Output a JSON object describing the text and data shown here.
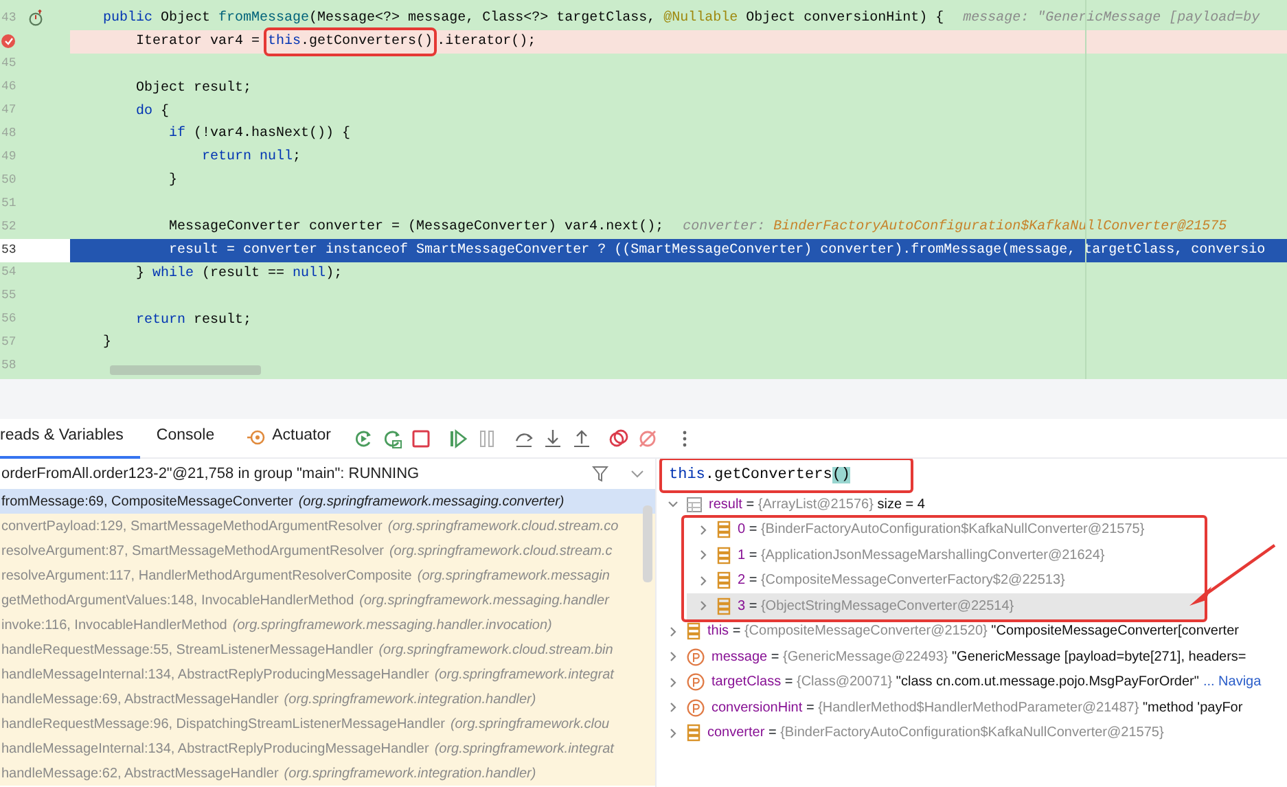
{
  "editor": {
    "lines": [
      {
        "number": "43",
        "override_marker": true,
        "segments": [
          {
            "text": "    public",
            "kind": "kw"
          },
          {
            "text": " Object ",
            "kind": "plain"
          },
          {
            "text": "fromMessage",
            "kind": "method"
          },
          {
            "text": "(Message<?> message, Class<?> targetClass, ",
            "kind": "plain"
          },
          {
            "text": "@Nullable",
            "kind": "annotation"
          },
          {
            "text": " Object conversionHint) {",
            "kind": "plain"
          }
        ],
        "hint": [
          {
            "text": "message: \"GenericMessage [payload=by",
            "kind": "hint"
          }
        ]
      },
      {
        "breakpoint": true,
        "segments": [
          {
            "text": "        Iterator var4 = ",
            "kind": "plain"
          },
          {
            "kind": "callout",
            "parts": [
              {
                "text": "this",
                "kind": "kw"
              },
              {
                "text": ".getConverters()",
                "kind": "plain"
              }
            ]
          },
          {
            "text": ".iterator();",
            "kind": "plain"
          }
        ]
      },
      {
        "number": "45"
      },
      {
        "number": "46",
        "segments": [
          {
            "text": "        Object result;",
            "kind": "plain"
          }
        ]
      },
      {
        "number": "47",
        "segments": [
          {
            "text": "        do",
            "kind": "kw"
          },
          {
            "text": " {",
            "kind": "plain"
          }
        ]
      },
      {
        "number": "48",
        "segments": [
          {
            "text": "            if",
            "kind": "kw"
          },
          {
            "text": " (!var4.hasNext()) {",
            "kind": "plain"
          }
        ]
      },
      {
        "number": "49",
        "segments": [
          {
            "text": "                return null",
            "kind": "kw"
          },
          {
            "text": ";",
            "kind": "plain"
          }
        ]
      },
      {
        "number": "50",
        "segments": [
          {
            "text": "            }",
            "kind": "plain"
          }
        ]
      },
      {
        "number": "51"
      },
      {
        "number": "52",
        "segments": [
          {
            "text": "            MessageConverter converter = (MessageConverter) var4.next();",
            "kind": "plain"
          }
        ],
        "hint": [
          {
            "text": "converter: ",
            "kind": "hint"
          },
          {
            "text": "BinderFactoryAutoConfiguration$KafkaNullConverter@21575",
            "kind": "hint_value"
          }
        ]
      },
      {
        "number": "53",
        "execution_point": true,
        "segments": [
          {
            "text": "            result = converter ",
            "kind": "plain"
          },
          {
            "text": "instanceof",
            "kind": "kw"
          },
          {
            "text": " SmartMessageConverter ? ((SmartMessageConverter) converter).fromMessage(message, targetClass, conversio",
            "kind": "plain"
          }
        ]
      },
      {
        "number": "54",
        "segments": [
          {
            "text": "        } ",
            "kind": "plain"
          },
          {
            "text": "while",
            "kind": "kw"
          },
          {
            "text": " (result == ",
            "kind": "plain"
          },
          {
            "text": "null",
            "kind": "kw"
          },
          {
            "text": ");",
            "kind": "plain"
          }
        ]
      },
      {
        "number": "55"
      },
      {
        "number": "56",
        "segments": [
          {
            "text": "        return",
            "kind": "kw"
          },
          {
            "text": " result;",
            "kind": "plain"
          }
        ]
      },
      {
        "number": "57",
        "segments": [
          {
            "text": "    }",
            "kind": "plain"
          }
        ]
      },
      {
        "number": "58"
      }
    ]
  },
  "debug_toolbar": {
    "tabs": [
      {
        "label": "reads & Variables",
        "selected": true,
        "kind": "plain"
      },
      {
        "label": "Console",
        "selected": false,
        "kind": "plain"
      },
      {
        "label": "Actuator",
        "selected": false,
        "kind": "actuator"
      }
    ]
  },
  "thread_selector": {
    "value": "orderFromAll.order123-2\"@21,758 in group \"main\": RUNNING"
  },
  "frames": [
    {
      "method": "fromMessage:69, CompositeMessageConverter",
      "package": "(org.springframework.messaging.converter)",
      "selected": true
    },
    {
      "method": "convertPayload:129, SmartMessageMethodArgumentResolver",
      "package": "(org.springframework.cloud.stream.co",
      "selected": false
    },
    {
      "method": "resolveArgument:87, SmartMessageMethodArgumentResolver",
      "package": "(org.springframework.cloud.stream.c",
      "selected": false
    },
    {
      "method": "resolveArgument:117, HandlerMethodArgumentResolverComposite",
      "package": "(org.springframework.messagin",
      "selected": false
    },
    {
      "method": "getMethodArgumentValues:148, InvocableHandlerMethod",
      "package": "(org.springframework.messaging.handler",
      "selected": false
    },
    {
      "method": "invoke:116, InvocableHandlerMethod",
      "package": "(org.springframework.messaging.handler.invocation)",
      "selected": false
    },
    {
      "method": "handleRequestMessage:55, StreamListenerMessageHandler",
      "package": "(org.springframework.cloud.stream.bin",
      "selected": false
    },
    {
      "method": "handleMessageInternal:134, AbstractReplyProducingMessageHandler",
      "package": "(org.springframework.integrat",
      "selected": false
    },
    {
      "method": "handleMessage:69, AbstractMessageHandler",
      "package": "(org.springframework.integration.handler)",
      "selected": false
    },
    {
      "method": "handleRequestMessage:96, DispatchingStreamListenerMessageHandler",
      "package": "(org.springframework.clou",
      "selected": false
    },
    {
      "method": "handleMessageInternal:134, AbstractReplyProducingMessageHandler",
      "package": "(org.springframework.integrat",
      "selected": false
    },
    {
      "method": "handleMessage:62, AbstractMessageHandler",
      "package": "(org.springframework.integration.handler)",
      "selected": false
    }
  ],
  "expression": {
    "value": "this.getConverters()",
    "highlighted": true
  },
  "variables": [
    {
      "kind": "list",
      "name": "result",
      "operator": "=",
      "ref": "{ArrayList@21576}",
      "value": "size = 4",
      "expanded": true,
      "selected": false,
      "children_highlighted": true,
      "children": [
        {
          "kind": "field",
          "name": "0",
          "operator": "=",
          "ref": "{BinderFactoryAutoConfiguration$KafkaNullConverter@21575}",
          "expanded": false,
          "selected": false
        },
        {
          "kind": "field",
          "name": "1",
          "operator": "=",
          "ref": "{ApplicationJsonMessageMarshallingConverter@21624}",
          "expanded": false,
          "selected": false
        },
        {
          "kind": "field",
          "name": "2",
          "operator": "=",
          "ref": "{CompositeMessageConverterFactory$2@22513}",
          "expanded": false,
          "selected": false
        },
        {
          "kind": "field",
          "name": "3",
          "operator": "=",
          "ref": "{ObjectStringMessageConverter@22514}",
          "expanded": false,
          "selected": true
        }
      ]
    },
    {
      "kind": "field",
      "name": "this",
      "operator": "=",
      "ref": "{CompositeMessageConverter@21520}",
      "value": "\"CompositeMessageConverter[converter",
      "expanded": false,
      "selected": false
    },
    {
      "kind": "param",
      "name": "message",
      "operator": "=",
      "ref": "{GenericMessage@22493}",
      "value": "\"GenericMessage [payload=byte[271], headers=",
      "expanded": false,
      "selected": false
    },
    {
      "kind": "param",
      "name": "targetClass",
      "operator": "=",
      "ref": "{Class@20071}",
      "value": "\"class cn.com.ut.message.pojo.MsgPayForOrder\"",
      "link": "... Naviga",
      "expanded": false,
      "selected": false
    },
    {
      "kind": "param",
      "name": "conversionHint",
      "operator": "=",
      "ref": "{HandlerMethod$HandlerMethodParameter@21487}",
      "value": "\"method 'payFor",
      "expanded": false,
      "selected": false
    },
    {
      "kind": "field",
      "name": "converter",
      "operator": "=",
      "ref": "{BinderFactoryAutoConfiguration$KafkaNullConverter@21575}",
      "expanded": false,
      "selected": false
    }
  ]
}
